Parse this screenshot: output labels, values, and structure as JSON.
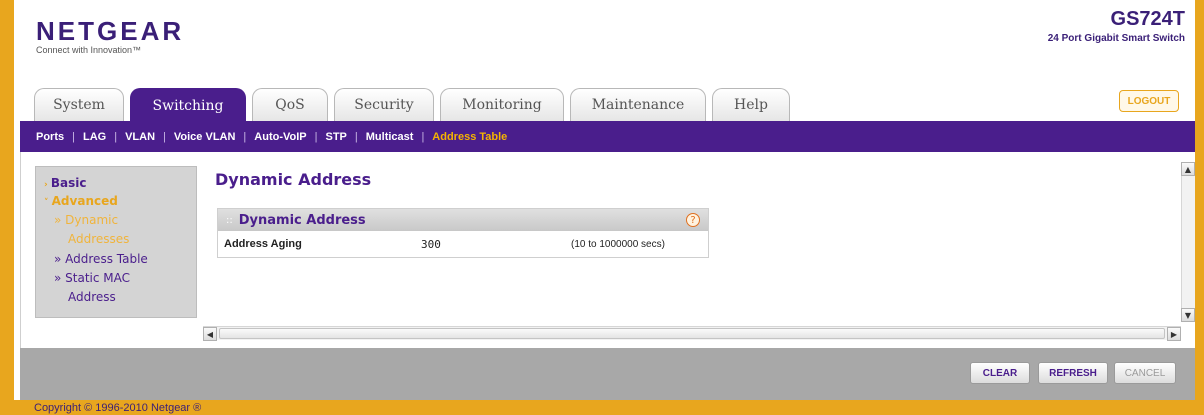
{
  "brand": {
    "logo": "NETGEAR",
    "tagline": "Connect with Innovation™",
    "model": "GS724T",
    "model_desc": "24 Port Gigabit Smart Switch"
  },
  "tabs": [
    "System",
    "Switching",
    "QoS",
    "Security",
    "Monitoring",
    "Maintenance",
    "Help"
  ],
  "active_tab": "Switching",
  "logout_label": "LOGOUT",
  "subnav": [
    "Ports",
    "LAG",
    "VLAN",
    "Voice VLAN",
    "Auto-VoIP",
    "STP",
    "Multicast",
    "Address Table"
  ],
  "active_subnav": "Address Table",
  "sidebar": {
    "basic": "Basic",
    "advanced": "Advanced",
    "items": [
      {
        "line1": "Dynamic",
        "line2": "Addresses"
      },
      {
        "line1": "Address Table",
        "line2": ""
      },
      {
        "line1": "Static MAC",
        "line2": "Address"
      }
    ]
  },
  "page_title": "Dynamic Address",
  "panel": {
    "title": "Dynamic Address",
    "help": "?",
    "rows": [
      {
        "label": "Address Aging",
        "value": "300",
        "range": "(10 to 1000000 secs)"
      }
    ]
  },
  "buttons": {
    "clear": "CLEAR",
    "refresh": "REFRESH",
    "cancel": "CANCEL"
  },
  "copyright": "Copyright © 1996-2010 Netgear ®"
}
